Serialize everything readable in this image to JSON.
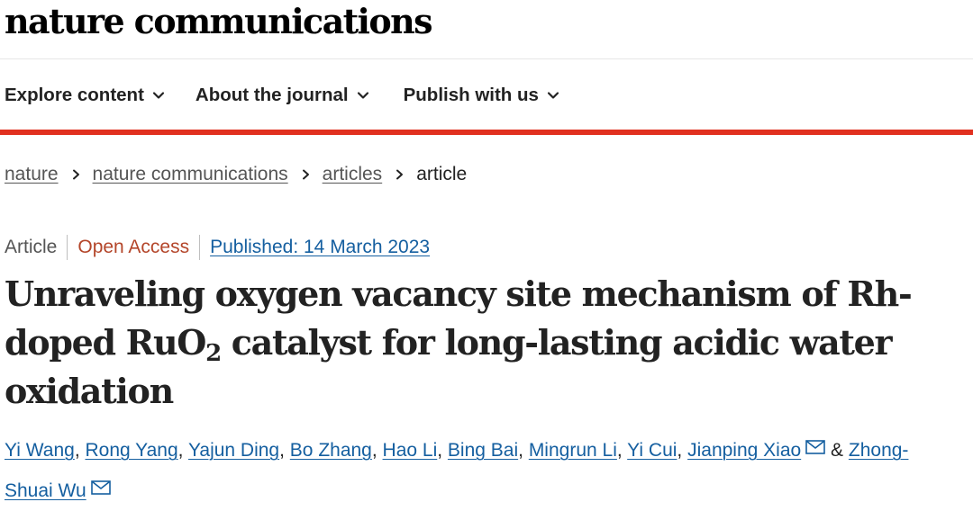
{
  "header": {
    "logo": "nature communications"
  },
  "nav": {
    "items": [
      {
        "label": "Explore content",
        "icon": "chevron-down-icon"
      },
      {
        "label": "About the journal",
        "icon": "chevron-down-icon"
      },
      {
        "label": "Publish with us",
        "icon": "chevron-down-icon"
      }
    ]
  },
  "colors": {
    "accent_rule": "#e1301f",
    "link": "#155fa0",
    "open_access": "#b4462a"
  },
  "breadcrumb": {
    "items": [
      {
        "label": "nature",
        "link": true
      },
      {
        "label": "nature communications",
        "link": true
      },
      {
        "label": "articles",
        "link": true
      },
      {
        "label": "article",
        "link": false
      }
    ]
  },
  "article": {
    "type": "Article",
    "access": "Open Access",
    "published": "Published: 14 March 2023",
    "title": {
      "line1": "Unraveling oxygen vacancy site mechanism of Rh-",
      "line2_before": "doped RuO",
      "line2_sub": "2",
      "line2_after": " catalyst for long-lasting acidic water",
      "line3": "oxidation"
    },
    "authors": [
      {
        "name": "Yi Wang"
      },
      {
        "name": "Rong Yang"
      },
      {
        "name": "Yajun Ding"
      },
      {
        "name": "Bo Zhang"
      },
      {
        "name": "Hao Li"
      },
      {
        "name": "Bing Bai"
      },
      {
        "name": "Mingrun Li"
      },
      {
        "name": "Yi Cui"
      },
      {
        "name": "Jianping Xiao",
        "corresponding": true
      },
      {
        "name_part1": "Zhong-",
        "name_part2": "Shuai Wu",
        "corresponding": true
      }
    ],
    "separator": ", ",
    "and": "&"
  }
}
